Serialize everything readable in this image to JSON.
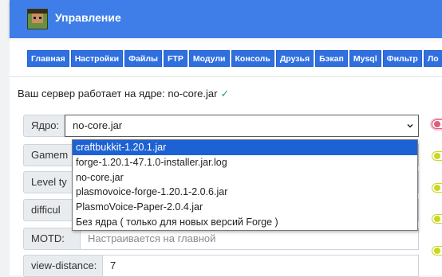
{
  "header": {
    "title": "Управление",
    "logo_icon": "minecraft-avatar-icon",
    "color": "#3f7ee8"
  },
  "tabs": [
    {
      "label": "Главная"
    },
    {
      "label": "Настройки"
    },
    {
      "label": "Файлы"
    },
    {
      "label": "FTP"
    },
    {
      "label": "Модули"
    },
    {
      "label": "Консоль"
    },
    {
      "label": "Друзья"
    },
    {
      "label": "Бэкап"
    },
    {
      "label": "Mysql"
    },
    {
      "label": "Фильтр"
    },
    {
      "label": "Ло"
    }
  ],
  "status": {
    "text": "Ваш сервер работает на ядре: no-core.jar",
    "icon": "check-icon"
  },
  "form": {
    "core": {
      "label": "Ядро:",
      "value": "no-core.jar"
    },
    "gamemode": {
      "label": "Gamem"
    },
    "level_type": {
      "label": "Level ty"
    },
    "difficulty": {
      "label": "difficul"
    },
    "motd": {
      "label": "MOTD:",
      "placeholder": "Настраивается на главной"
    },
    "view_distance": {
      "label": "view-distance:",
      "value": "7"
    }
  },
  "dropdown": {
    "options": [
      {
        "label": "craftbukkit-1.20.1.jar",
        "selected": true
      },
      {
        "label": "forge-1.20.1-47.1.0-installer.jar.log"
      },
      {
        "label": "no-core.jar"
      },
      {
        "label": "plasmovoice-forge-1.20.1-2.0.6.jar"
      },
      {
        "label": "PlasmoVoice-Paper-2.0.4.jar"
      },
      {
        "label": "Без ядра ( только для новых версий Forge )"
      }
    ]
  },
  "colors": {
    "tab": "#2f6fe0",
    "selected_option": "#1d62d4",
    "toggle_accent": "#c9d820",
    "toggle_focus": "#e05b7a"
  }
}
